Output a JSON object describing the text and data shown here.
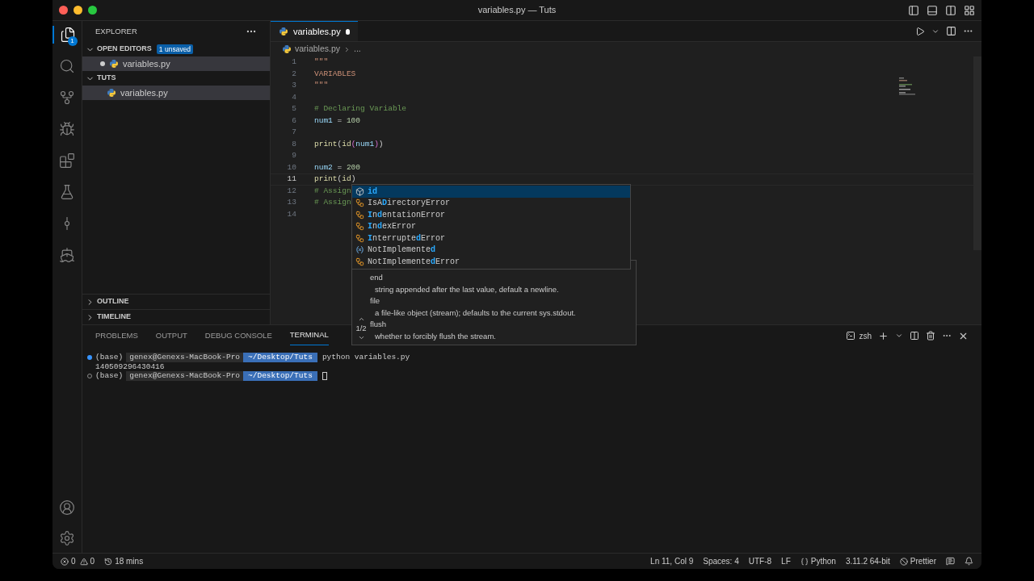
{
  "window": {
    "title": "variables.py — Tuts"
  },
  "activity_bar": {
    "items": [
      {
        "kind": "files",
        "selected": true,
        "badge": "1"
      },
      {
        "kind": "search",
        "selected": false
      },
      {
        "kind": "source-control",
        "selected": false
      },
      {
        "kind": "run",
        "selected": false
      },
      {
        "kind": "extensions",
        "selected": false
      },
      {
        "kind": "testing",
        "selected": false
      },
      {
        "kind": "graph",
        "selected": false
      },
      {
        "kind": "docker",
        "selected": false
      }
    ]
  },
  "sidebar": {
    "title": "EXPLORER",
    "sections": [
      {
        "title": "OPEN EDITORS",
        "expanded": true,
        "badge": "1 unsaved",
        "items": [
          {
            "label": "variables.py",
            "dirty": true,
            "selected": true
          }
        ]
      },
      {
        "title": "TUTS",
        "expanded": true,
        "items": [
          {
            "label": "variables.py",
            "dirty": false,
            "selected": true
          }
        ]
      },
      {
        "title": "OUTLINE",
        "expanded": false
      },
      {
        "title": "TIMELINE",
        "expanded": false
      }
    ]
  },
  "editor": {
    "tabs": [
      {
        "label": "variables.py",
        "dirty": true,
        "selected": true
      }
    ],
    "breadcrumb": [
      "variables.py",
      "..."
    ],
    "lines": [
      {
        "number": "1",
        "current": false,
        "tokens": [
          {
            "text": "\"\"\"",
            "kind": "string"
          }
        ]
      },
      {
        "number": "2",
        "current": false,
        "tokens": [
          {
            "text": "VARIABLES",
            "kind": "string"
          }
        ]
      },
      {
        "number": "3",
        "current": false,
        "tokens": [
          {
            "text": "\"\"\"",
            "kind": "string"
          }
        ]
      },
      {
        "number": "4",
        "current": false
      },
      {
        "number": "5",
        "current": false,
        "tokens": [
          {
            "text": "# Declaring Variable",
            "kind": "comment"
          }
        ]
      },
      {
        "number": "6",
        "current": false,
        "tokens": [
          {
            "text": "num1",
            "kind": "variable"
          },
          {
            "text": " = ",
            "kind": "plain"
          },
          {
            "text": "100",
            "kind": "number"
          }
        ]
      },
      {
        "number": "7",
        "current": false
      },
      {
        "number": "8",
        "current": false,
        "tokens": [
          {
            "text": "print",
            "kind": "function"
          },
          {
            "text": "(",
            "kind": "plain"
          },
          {
            "text": "id",
            "kind": "function"
          },
          {
            "text": "(",
            "kind": "bracket"
          },
          {
            "text": "num1",
            "kind": "variable"
          },
          {
            "text": ")",
            "kind": "bracket"
          },
          {
            "text": ")",
            "kind": "plain"
          }
        ]
      },
      {
        "number": "9",
        "current": false
      },
      {
        "number": "10",
        "current": false,
        "tokens": [
          {
            "text": "num2",
            "kind": "variable"
          },
          {
            "text": " = ",
            "kind": "plain"
          },
          {
            "text": "200",
            "kind": "number"
          }
        ]
      },
      {
        "number": "11",
        "current": true,
        "tokens": [
          {
            "text": "print",
            "kind": "function"
          },
          {
            "text": "(",
            "kind": "plain"
          },
          {
            "text": "id",
            "kind": "function"
          },
          {
            "text": ")",
            "kind": "plain"
          }
        ]
      },
      {
        "number": "12",
        "current": false,
        "tokens": [
          {
            "text": "# Assign",
            "kind": "comment"
          }
        ]
      },
      {
        "number": "13",
        "current": false,
        "tokens": [
          {
            "text": "# Assign",
            "kind": "comment"
          }
        ]
      },
      {
        "number": "14",
        "current": false
      }
    ],
    "suggestions": [
      {
        "kind": "function",
        "selected": true,
        "parts": [
          {
            "text": "id",
            "match": true
          }
        ]
      },
      {
        "kind": "class",
        "selected": false,
        "parts": [
          {
            "text": "IsA",
            "match": false
          },
          {
            "text": "D",
            "match": true
          },
          {
            "text": "irectoryError",
            "match": false
          }
        ]
      },
      {
        "kind": "class",
        "selected": false,
        "parts": [
          {
            "text": "I",
            "match": true
          },
          {
            "text": "n",
            "match": false
          },
          {
            "text": "d",
            "match": true
          },
          {
            "text": "entationError",
            "match": false
          }
        ]
      },
      {
        "kind": "class",
        "selected": false,
        "parts": [
          {
            "text": "I",
            "match": true
          },
          {
            "text": "n",
            "match": false
          },
          {
            "text": "d",
            "match": true
          },
          {
            "text": "exError",
            "match": false
          }
        ]
      },
      {
        "kind": "class",
        "selected": false,
        "parts": [
          {
            "text": "I",
            "match": true
          },
          {
            "text": "nterrupte",
            "match": false
          },
          {
            "text": "d",
            "match": true
          },
          {
            "text": "Error",
            "match": false
          }
        ]
      },
      {
        "kind": "variable",
        "selected": false,
        "parts": [
          {
            "text": "NotImplemente",
            "match": false
          },
          {
            "text": "d",
            "match": true
          }
        ]
      },
      {
        "kind": "class",
        "selected": false,
        "parts": [
          {
            "text": "NotImplemente",
            "match": false
          },
          {
            "text": "d",
            "match": true
          },
          {
            "text": "Error",
            "match": false
          }
        ]
      }
    ],
    "signature_help": {
      "counter": "1/2",
      "params": [
        {
          "name": "end",
          "doc": "string appended after the last value, default a newline."
        },
        {
          "name": "file",
          "doc": "a file-like object (stream); defaults to the current sys.stdout."
        },
        {
          "name": "flush",
          "doc": "whether to forcibly flush the stream."
        }
      ]
    }
  },
  "panel": {
    "tabs": [
      {
        "label": "PROBLEMS",
        "selected": false
      },
      {
        "label": "OUTPUT",
        "selected": false
      },
      {
        "label": "DEBUG CONSOLE",
        "selected": false
      },
      {
        "label": "TERMINAL",
        "selected": true
      }
    ],
    "shell": "zsh",
    "terminal": [
      {
        "kind": "prompt",
        "finished": true,
        "env": "(base)",
        "host": "genex@Genexs-MacBook-Pro",
        "path": "~/Desktop/Tuts",
        "command": "python variables.py"
      },
      {
        "kind": "output",
        "text": "140509296430416"
      },
      {
        "kind": "prompt",
        "finished": false,
        "env": "(base)",
        "host": "genex@Genexs-MacBook-Pro",
        "path": "~/Desktop/Tuts"
      }
    ]
  },
  "status_bar": {
    "errors": "0",
    "warnings": "0",
    "time": "18 mins",
    "position": "Ln 11, Col 9",
    "spaces": "Spaces: 4",
    "encoding": "UTF-8",
    "eol": "LF",
    "language": "Python",
    "interpreter": "3.11.2 64-bit",
    "formatter": "Prettier"
  }
}
